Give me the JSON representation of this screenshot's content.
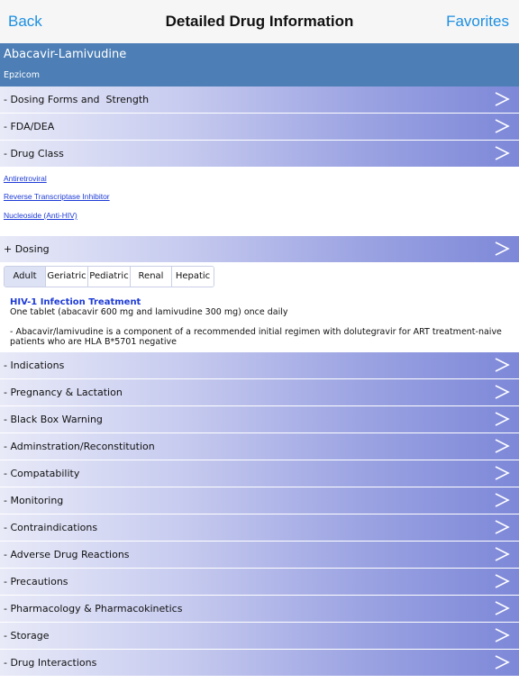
{
  "nav": {
    "back": "Back",
    "title": "Detailed Drug Information",
    "favorites": "Favorites"
  },
  "drug": {
    "name": "Abacavir-Lamivudine",
    "brand": "Epzicom"
  },
  "sections_top": [
    {
      "label": "- Dosing Forms and  Strength"
    },
    {
      "label": "- FDA/DEA"
    },
    {
      "label": "- Drug Class"
    }
  ],
  "drug_class_links": [
    "Antiretroviral",
    "Reverse Transcriptase Inhibitor",
    "Nucleoside (Anti-HIV)"
  ],
  "dosing_section": {
    "label": "+ Dosing"
  },
  "dosing_tabs": [
    "Adult",
    "Geriatric",
    "Pediatric",
    "Renal",
    "Hepatic"
  ],
  "dosing_active_tab": "Adult",
  "dosing_content": {
    "title": "HIV-1 Infection Treatment",
    "line1": "One tablet (abacavir 600 mg and lamivudine 300 mg) once daily",
    "line2": "- Abacavir/lamivudine is a component of a recommended initial regimen with dolutegravir for ART treatment-naive",
    "line3": "patients who are HLA B*5701 negative"
  },
  "sections_bottom": [
    {
      "label": "- Indications"
    },
    {
      "label": "- Pregnancy & Lactation"
    },
    {
      "label": "- Black Box Warning"
    },
    {
      "label": "- Adminstration/Reconstitution"
    },
    {
      "label": "- Compatability"
    },
    {
      "label": "- Monitoring"
    },
    {
      "label": "- Contraindications"
    },
    {
      "label": "- Adverse Drug Reactions"
    },
    {
      "label": "- Precautions"
    },
    {
      "label": "- Pharmacology & Pharmacokinetics"
    },
    {
      "label": "- Storage"
    },
    {
      "label": "- Drug Interactions"
    }
  ],
  "icons": {
    "row_chevron": "chevron-right-icon"
  },
  "colors": {
    "accent": "#1d8fe0",
    "header": "#4d7fb6",
    "link": "#1d3bd6"
  }
}
